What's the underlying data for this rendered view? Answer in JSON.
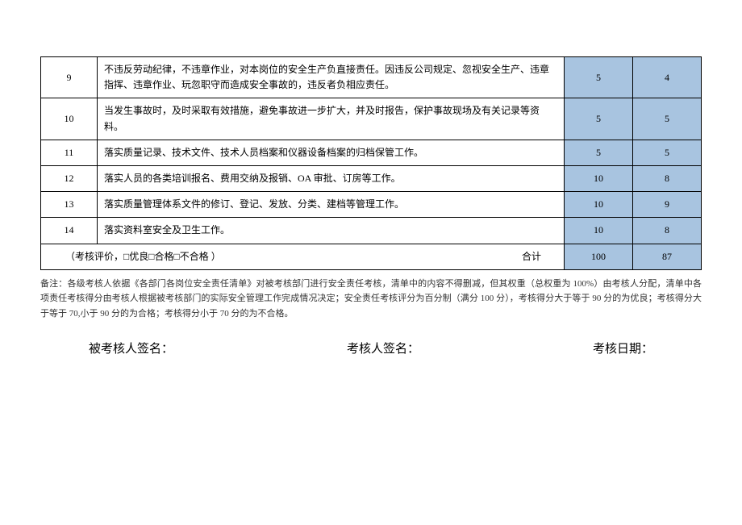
{
  "rows": [
    {
      "num": "9",
      "desc": "不违反劳动纪律，不违章作业，对本岗位的安全生产负直接责任。因违反公司规定、忽视安全生产、违章指挥、违章作业、玩忽职守而造成安全事故的，违反者负相应责任。",
      "score1": "5",
      "score2": "4"
    },
    {
      "num": "10",
      "desc": "当发生事故时，及时采取有效措施，避免事故进一步扩大，并及时报告，保护事故现场及有关记录等资料。",
      "score1": "5",
      "score2": "5"
    },
    {
      "num": "11",
      "desc": "落实质量记录、技术文件、技术人员档案和仪器设备档案的归档保管工作。",
      "score1": "5",
      "score2": "5"
    },
    {
      "num": "12",
      "desc": "落实人员的各类培训报名、费用交纳及报销、OA 审批、订房等工作。",
      "score1": "10",
      "score2": "8"
    },
    {
      "num": "13",
      "desc": "落实质量管理体系文件的修订、登记、发放、分类、建档等管理工作。",
      "score1": "10",
      "score2": "9"
    },
    {
      "num": "14",
      "desc": "落实资料室安全及卫生工作。",
      "score1": "10",
      "score2": "8"
    }
  ],
  "summary": {
    "label": "（考核评价，□优良□合格□不合格                         ）",
    "totalLabel": "合计",
    "score1": "100",
    "score2": "87"
  },
  "note": "备注：各级考核人依据《各部门各岗位安全责任清单》对被考核部门进行安全责任考核，清单中的内容不得删减，但其权重（总权重为 100%）由考核人分配，清单中各项责任考核得分由考核人根据被考核部门的实际安全管理工作完成情况决定；安全责任考核评分为百分制（满分 100 分），考核得分大于等于 90 分的为优良；考核得分大于等于 70,小于 90 分的为合格；考核得分小于 70 分的为不合格。",
  "signatures": {
    "signed": "被考核人签名：",
    "assessor": "考核人签名：",
    "date": "考核日期："
  }
}
